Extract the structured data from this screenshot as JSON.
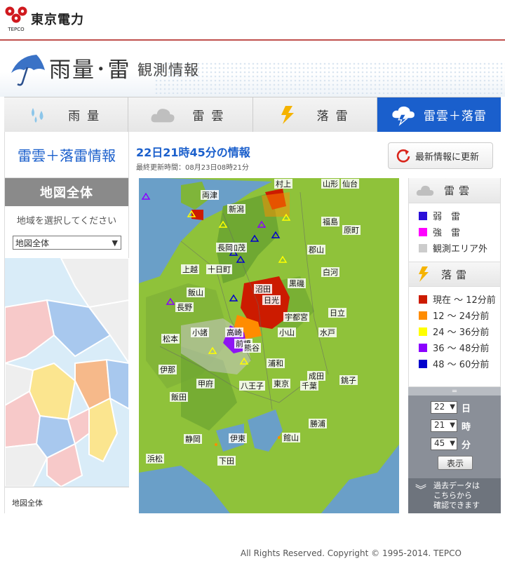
{
  "header": {
    "logo_text": "東京電力",
    "logo_sub": "TEPCO"
  },
  "banner": {
    "title": "雨量･雷",
    "subtitle": "観測情報"
  },
  "tabs": [
    {
      "label": "雨量",
      "icon": "raindrops-icon"
    },
    {
      "label": "雷雲",
      "icon": "cloud-icon"
    },
    {
      "label": "落雷",
      "icon": "lightning-icon"
    },
    {
      "label": "雷雲＋落雷",
      "icon": "cloud-lightning-icon",
      "active": true
    }
  ],
  "info": {
    "section_title": "雷雲＋落雷情報",
    "time": "22日21時45分の情報",
    "updated": "最終更新時間：08月23日08時21分",
    "refresh_label": "最新情報に更新"
  },
  "region": {
    "heading": "地図全体",
    "prompt": "地域を選択してください",
    "selected": "地図全体",
    "footer_label": "地図全体"
  },
  "map_labels": [
    "村上",
    "山形",
    "仙台",
    "両津",
    "新潟",
    "福島",
    "原町",
    "加茂",
    "長岡",
    "郡山",
    "上越",
    "十日町",
    "白河",
    "飯山",
    "沼田",
    "日光",
    "黒磯",
    "長野",
    "宇都宮",
    "日立",
    "小諸",
    "高崎",
    "小山",
    "水戸",
    "松本",
    "前橋",
    "熊谷",
    "伊那",
    "甲府",
    "八王子",
    "浦和",
    "成田",
    "銚子",
    "飯田",
    "東京",
    "千葉",
    "静岡",
    "伊東",
    "館山",
    "勝浦",
    "浜松",
    "下田"
  ],
  "legend": {
    "cloud_head": "雷雲",
    "cloud_items": [
      {
        "label": "弱　雷",
        "color": "#2a0fd8"
      },
      {
        "label": "強　雷",
        "color": "#ff00ff"
      },
      {
        "label": "観測エリア外",
        "color": "#cccccc"
      }
    ],
    "strike_head": "落雷",
    "strike_items": [
      {
        "label": "現在 ～ 12分前",
        "color": "#cc1b00"
      },
      {
        "label": "12 ～ 24分前",
        "color": "#ff8c00"
      },
      {
        "label": "24 ～ 36分前",
        "color": "#ffff00"
      },
      {
        "label": "36 ～ 48分前",
        "color": "#8b00ff"
      },
      {
        "label": "48 ～ 60分前",
        "color": "#0000cc"
      }
    ]
  },
  "control": {
    "day": "22",
    "day_unit": "日",
    "hour": "21",
    "hour_unit": "時",
    "minute": "45",
    "minute_unit": "分",
    "show_label": "表示"
  },
  "past": {
    "line1": "過去データは",
    "line2": "こちらから",
    "line3": "確認できます"
  },
  "footer": "All Rights Reserved. Copyright © 1995-2014. TEPCO"
}
